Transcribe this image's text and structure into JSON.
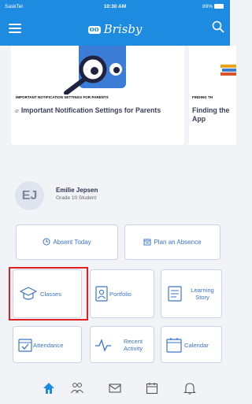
{
  "status_bar": {
    "carrier": "SaskTel",
    "time": "10:30 AM",
    "battery": "89%"
  },
  "header": {
    "brand": "Brisby",
    "brand_mark": "oo",
    "icons": [
      "menu-icon",
      "search-icon"
    ]
  },
  "cards": [
    {
      "caption": "IMPORTANT NOTIFICATION SETTINGS FOR PARENTS",
      "title": "Important Notification Settings for Parents"
    },
    {
      "caption": "FINDING TH",
      "title": "Finding the App"
    }
  ],
  "profile": {
    "initials": "EJ",
    "name": "Emilie Jepsen",
    "grade": "Grade 10 Student"
  },
  "actions": {
    "absent": "Absent Today",
    "plan": "Plan an Absence"
  },
  "tiles": {
    "classes": "Classes",
    "portfolio": "Portfolio",
    "learning_story_1": "Learning",
    "learning_story_2": "Story",
    "attendance": "Attendance",
    "recent_activity_1": "Recent",
    "recent_activity_2": "Activity",
    "calendar": "Calendar"
  },
  "tabbar": [
    "home-icon",
    "people-icon",
    "mail-icon",
    "calendar-icon",
    "bell-icon"
  ],
  "colors": {
    "header": "#1d8be0",
    "accent": "#3c74c8",
    "highlight": "#e02020",
    "background": "#f2f3f6"
  }
}
